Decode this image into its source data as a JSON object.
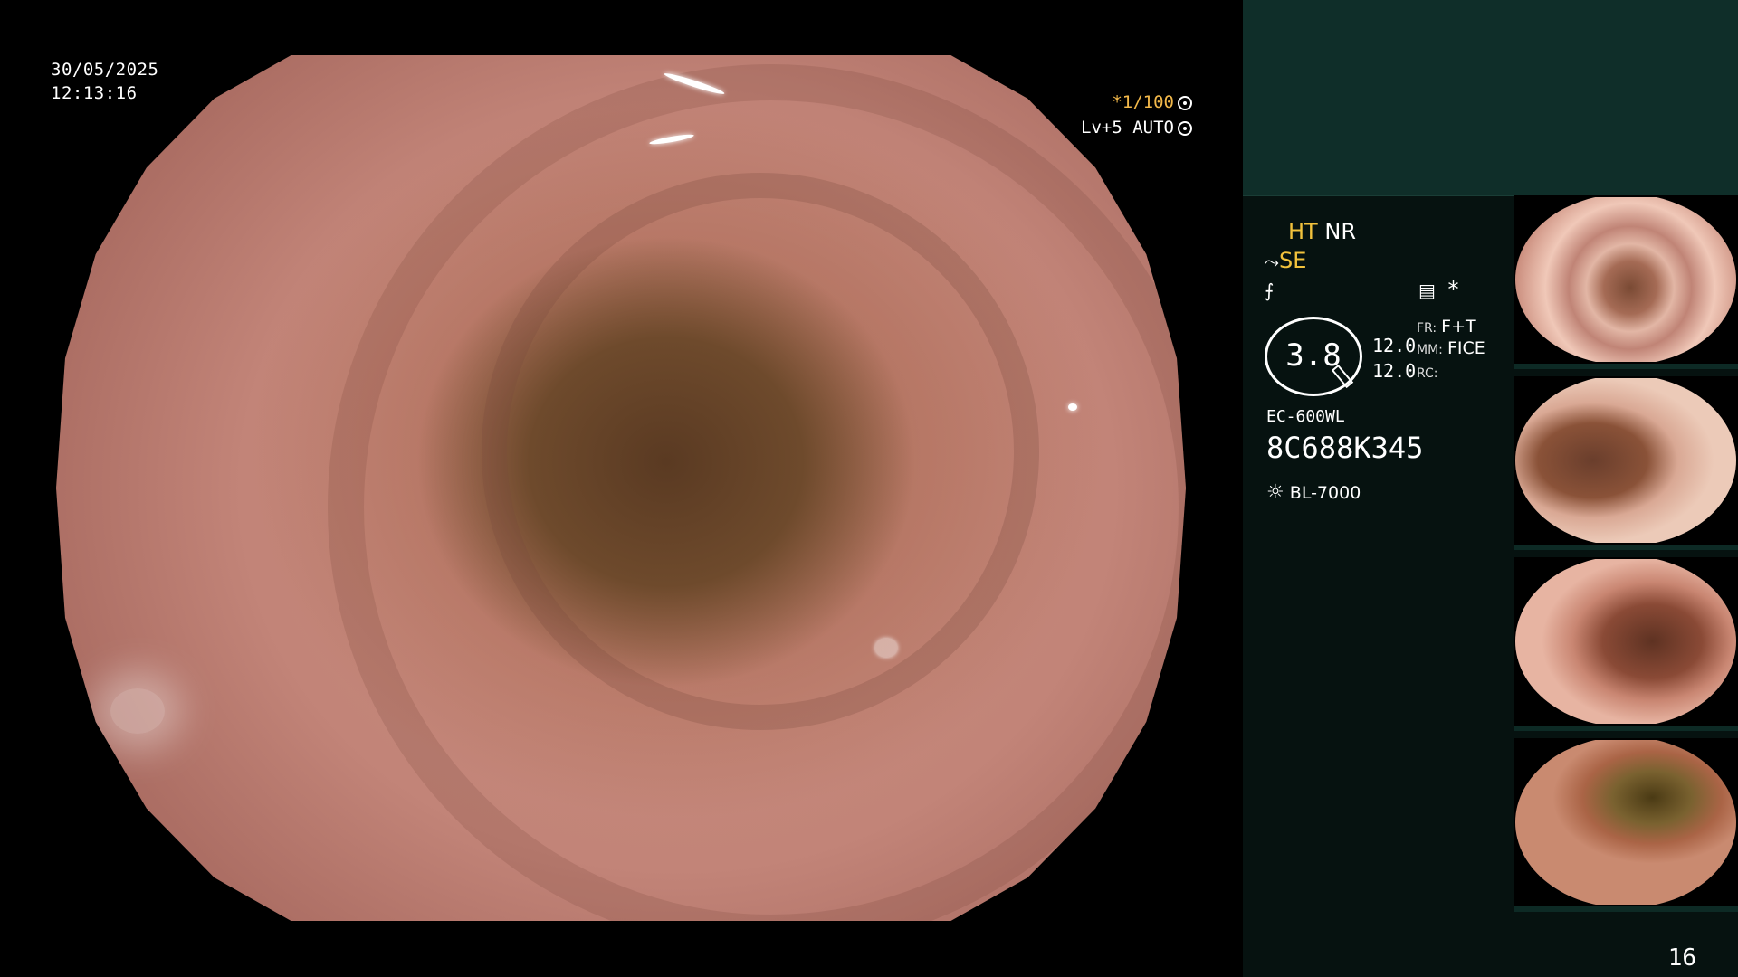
{
  "overlay": {
    "date": "30/05/2025",
    "time": "12:13:16",
    "shutter": "*1/100",
    "level": "Lv+5",
    "iris_mode": "AUTO"
  },
  "status": {
    "ht": "HT",
    "nr": "NR",
    "se": "SE",
    "asterisk": "*",
    "zoom": "3.8",
    "fr_label": "FR:",
    "fr_value": "F+T",
    "mm_label": "MM:",
    "mm_value": "FICE",
    "rc_label": "RC:",
    "value_1": "12.0",
    "value_2": "12.0",
    "scope_model": "EC-600WL",
    "serial": "8C688K345",
    "light_source": "BL-7000"
  },
  "page_number": "16",
  "colors": {
    "panel_bg": "#061210",
    "top_band": "#0f2e29",
    "accent_yellow": "#f2c23c",
    "shutter_amber": "#f2b84a"
  },
  "thumbnails": [
    {
      "index": "1"
    },
    {
      "index": "2"
    },
    {
      "index": "3"
    },
    {
      "index": "4"
    }
  ]
}
